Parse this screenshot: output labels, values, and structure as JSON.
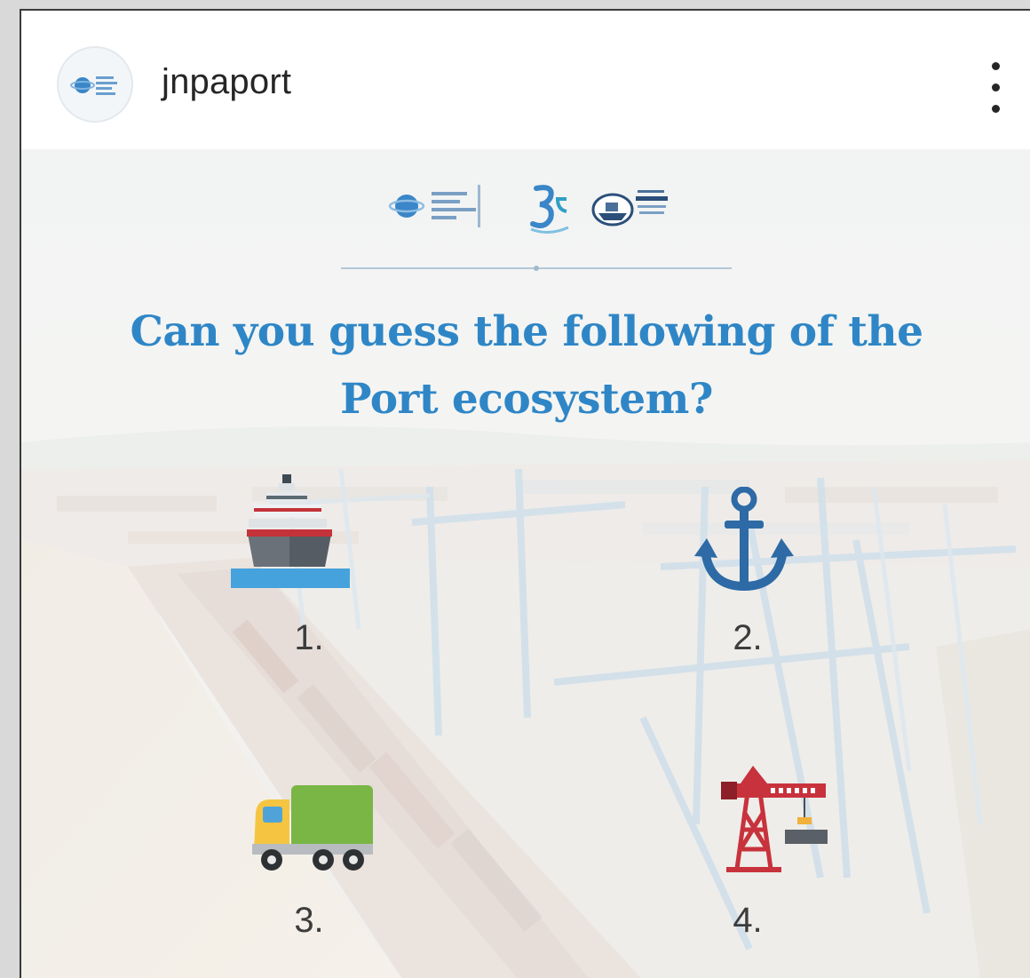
{
  "post": {
    "username": "jnpaport",
    "avatar_icon": "jnpa-logo-icon",
    "more_icon": "more-vertical-icon"
  },
  "media": {
    "headline_line1": "Can you guess the following of the",
    "headline_line2": "Port ecosystem?",
    "accent_color": "#2f86c6",
    "items": [
      {
        "number": "1.",
        "icon": "ship-icon"
      },
      {
        "number": "2.",
        "icon": "anchor-icon"
      },
      {
        "number": "3.",
        "icon": "truck-icon"
      },
      {
        "number": "4.",
        "icon": "crane-icon"
      }
    ]
  }
}
